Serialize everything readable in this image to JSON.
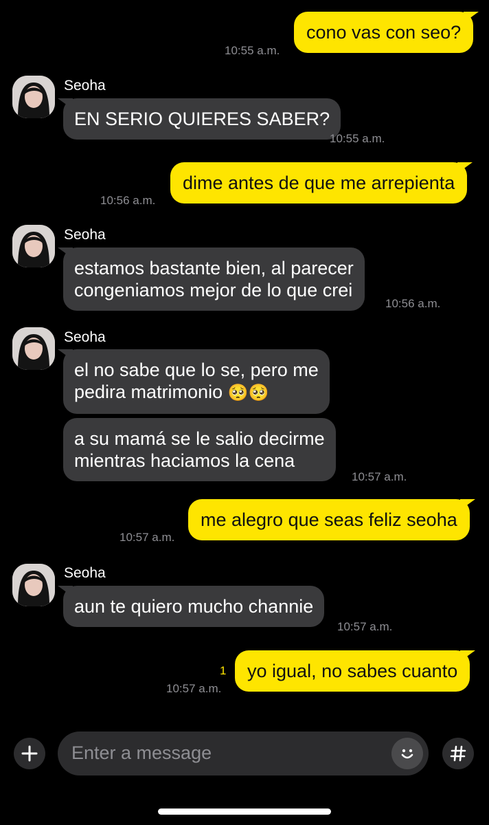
{
  "contact": {
    "name": "Seoha"
  },
  "messages": [
    {
      "from": "me",
      "text": "cono vas con seo?",
      "time": "10:55 a.m."
    },
    {
      "from": "them",
      "text": "EN SERIO QUIERES SABER?",
      "time": "10:55 a.m."
    },
    {
      "from": "me",
      "text": "dime antes de que me arrepienta",
      "time": "10:56 a.m."
    },
    {
      "from": "them",
      "lines": [
        "estamos bastante bien, al parecer",
        "congeniamos mejor de lo que crei"
      ],
      "time": "10:56 a.m."
    },
    {
      "from": "them",
      "lines": [
        "el no sabe que lo se, pero me",
        "pedira matrimonio"
      ],
      "emoji": "🥺🥺"
    },
    {
      "from": "them",
      "lines": [
        "a su mamá se le salio decirme",
        "mientras haciamos la cena"
      ],
      "time": "10:57 a.m."
    },
    {
      "from": "me",
      "text": "me alegro que seas feliz seoha",
      "time": "10:57 a.m."
    },
    {
      "from": "them",
      "text": "aun te quiero mucho channie",
      "time": "10:57 a.m."
    },
    {
      "from": "me",
      "text": "yo igual, no sabes cuanto",
      "time": "10:57 a.m.",
      "unread": "1"
    }
  ],
  "composer": {
    "placeholder": "Enter a message"
  },
  "colors": {
    "outgoing": "#FEE500",
    "incoming": "#3A3A3C",
    "background": "#000000"
  },
  "icons": {
    "add": "plus-icon",
    "emoji": "smiley-icon",
    "hashtag": "hashtag-icon"
  }
}
